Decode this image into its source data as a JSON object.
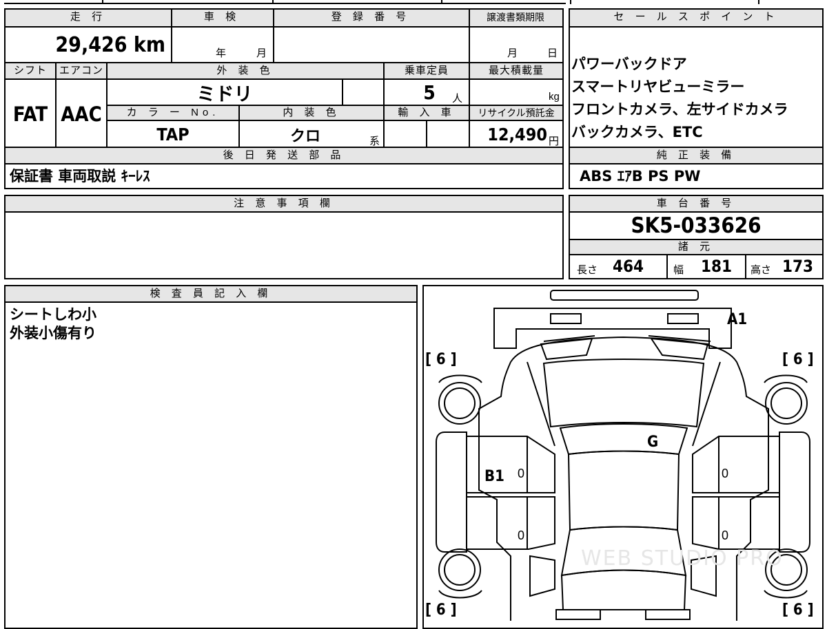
{
  "top": {
    "headers": {
      "mileage": "走 行",
      "inspection": "車 検",
      "registration_number": "登 録 番 号",
      "transfer_deadline": "譲渡書類期限",
      "sales_points": "セ ー ル ス ポ イ ン ト"
    },
    "mileage_value": "29,426 km",
    "inspection_year_unit": "年",
    "inspection_month_unit": "月",
    "deadline_month_unit": "月",
    "deadline_day_unit": "日"
  },
  "spec": {
    "shift_label": "シフト",
    "aircon_label": "エアコン",
    "exterior_color_label": "外 装 色",
    "capacity_label": "乗車定員",
    "max_load_label": "最大積載量",
    "shift_value": "FAT",
    "aircon_value": "AAC",
    "exterior_color_value": "ミドリ",
    "capacity_value": "5",
    "capacity_unit": "人",
    "max_load_unit": "kg",
    "color_no_label": "カ ラ ー No.",
    "interior_color_label": "内 装 色",
    "import_label": "輸 入 車",
    "recycle_label": "リサイクル預託金",
    "color_no_value": "TAP",
    "interior_color_value": "クロ",
    "interior_color_suffix": "系",
    "recycle_value": "12,490",
    "recycle_unit": "円"
  },
  "later_parts": {
    "header": "後 日 発 送 部 品",
    "value": "保証書 車両取説 ｷｰﾚｽ"
  },
  "sales_points": [
    "パワーバックドア",
    "スマートリヤビューミラー",
    "フロントカメラ、左サイドカメラ",
    "バックカメラ、ETC"
  ],
  "standard_equipment": {
    "header": "純 正 装 備",
    "value": "ABS ｴｱB PS PW"
  },
  "notes": {
    "header": "注 意 事 項 欄"
  },
  "chassis": {
    "header": "車 台 番 号",
    "value": "SK5-033626"
  },
  "dimensions": {
    "header": "諸 元",
    "length_label": "長さ",
    "length_value": "464",
    "width_label": "幅",
    "width_value": "181",
    "height_label": "高さ",
    "height_value": "173"
  },
  "inspector": {
    "header": "検 査 員 記 入 欄",
    "lines": [
      "シートしわ小",
      "外装小傷有り"
    ]
  },
  "diagram": {
    "marks": {
      "a1": "A1",
      "g": "G",
      "b1": "B1",
      "tire_fl": "[ 6 ]",
      "tire_fr": "[ 6 ]",
      "tire_rl": "[ 6 ]",
      "tire_rr": "[ 6 ]",
      "zero_1": "0",
      "zero_2": "0",
      "zero_3": "0",
      "zero_4": "0"
    },
    "watermark": "WEB STUDIO PRO"
  }
}
